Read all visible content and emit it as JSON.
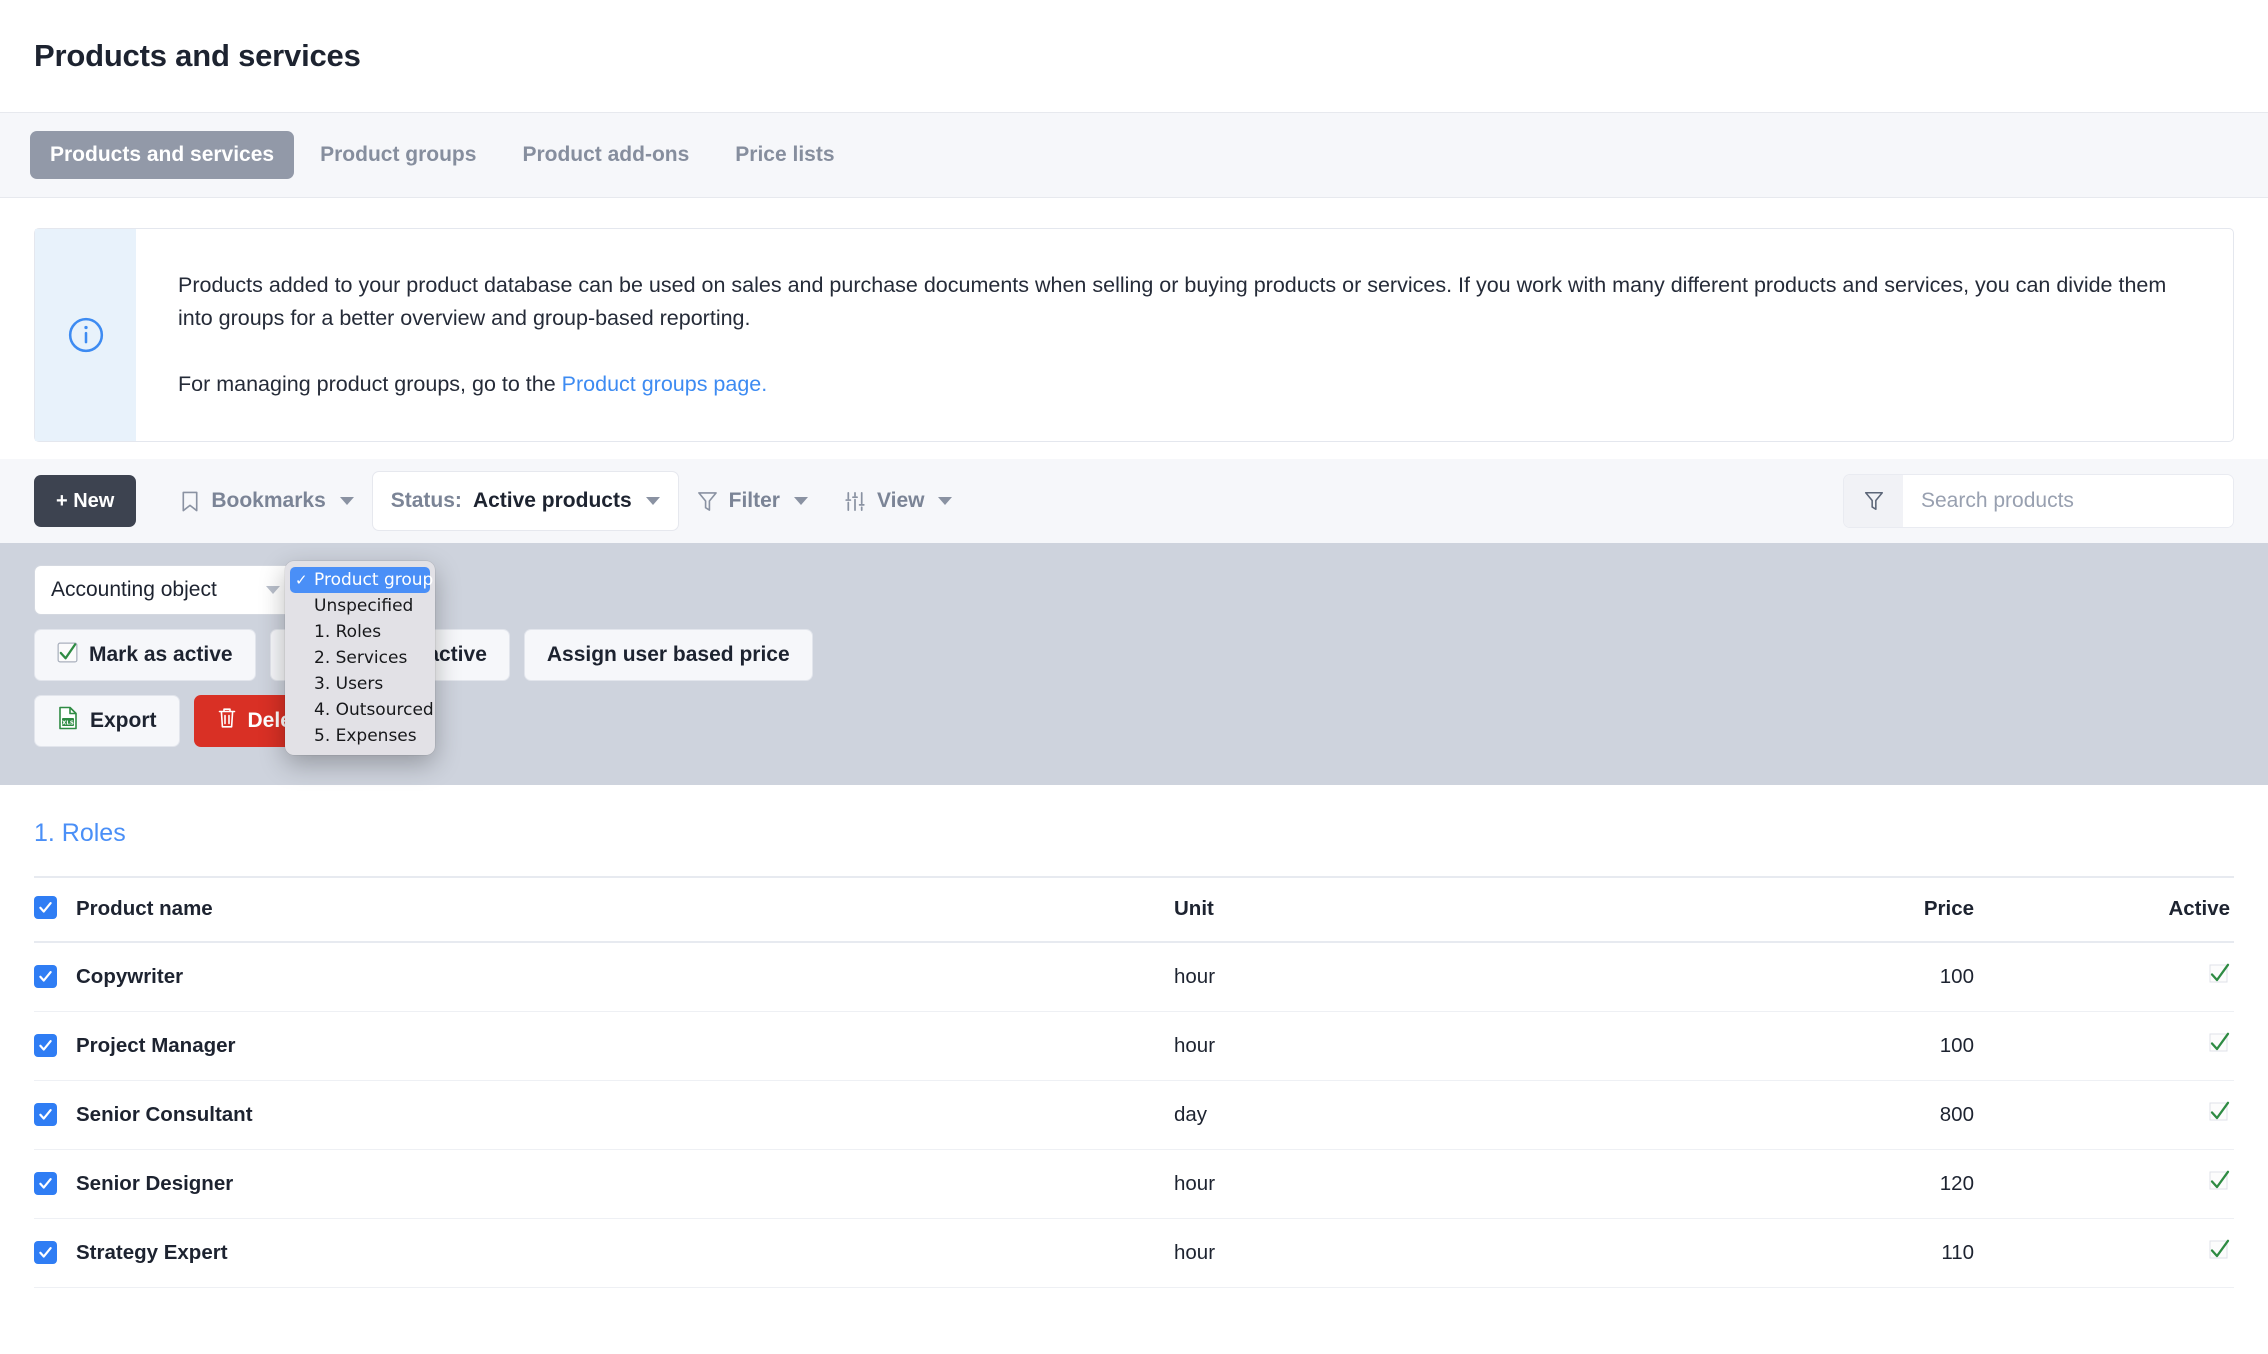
{
  "header": {
    "title": "Products and services"
  },
  "tabs": [
    {
      "label": "Products and services",
      "active": true
    },
    {
      "label": "Product groups",
      "active": false
    },
    {
      "label": "Product add-ons",
      "active": false
    },
    {
      "label": "Price lists",
      "active": false
    }
  ],
  "info": {
    "icon": "info-circle-icon",
    "paragraph1": "Products added to your product database can be used on sales and purchase documents when selling or buying products or services. If you work with many different products and services, you can divide them into groups for a better overview and group-based reporting.",
    "paragraph2_prefix": "For managing product groups, go to the ",
    "link_text": "Product groups page.",
    "accent": "#3d8bf2",
    "bg": "#e8f2fb"
  },
  "toolbar": {
    "new_label": "+ New",
    "bookmarks_label": "Bookmarks",
    "status_prefix": "Status:",
    "status_value": "Active products",
    "filter_label": "Filter",
    "view_label": "View",
    "search_placeholder": "Search products",
    "search_value": ""
  },
  "actions": {
    "select_value": "Accounting object",
    "mark_active_label": "Mark as active",
    "mark_inactive_label": "Mark as inactive",
    "assign_price_label": "Assign user based price",
    "export_label": "Export",
    "delete_label": "Delete"
  },
  "dropdown": {
    "open": true,
    "selected": "Product group",
    "items": [
      "Product group",
      "Unspecified",
      "1. Roles",
      "2. Services",
      "3. Users",
      "4. Outsourced",
      "5. Expenses"
    ]
  },
  "table": {
    "group_title": "1. Roles",
    "columns": [
      "Product name",
      "Unit",
      "Price",
      "Active"
    ],
    "header_checked": true,
    "rows": [
      {
        "checked": true,
        "name": "Copywriter",
        "unit": "hour",
        "price": "100",
        "active": true
      },
      {
        "checked": true,
        "name": "Project Manager",
        "unit": "hour",
        "price": "100",
        "active": true
      },
      {
        "checked": true,
        "name": "Senior Consultant",
        "unit": "day",
        "price": "800",
        "active": true
      },
      {
        "checked": true,
        "name": "Senior Designer",
        "unit": "hour",
        "price": "120",
        "active": true
      },
      {
        "checked": true,
        "name": "Strategy Expert",
        "unit": "hour",
        "price": "110",
        "active": true
      }
    ]
  }
}
